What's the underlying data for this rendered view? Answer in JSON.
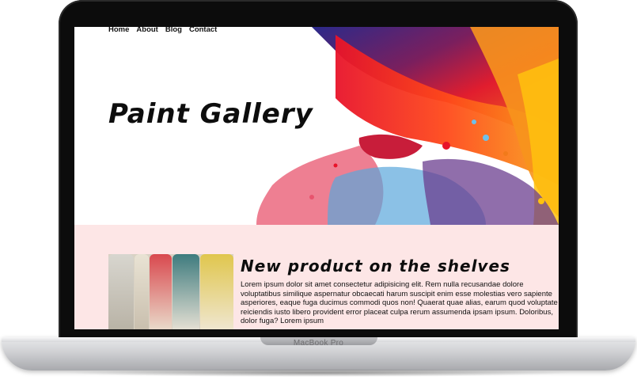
{
  "nav": {
    "items": [
      "Home",
      "About",
      "Blog",
      "Contact"
    ]
  },
  "hero": {
    "title": "Paint Gallery"
  },
  "section": {
    "heading": "New product on the shelves",
    "body": "Lorem ipsum dolor sit amet consectetur adipisicing elit. Rem nulla recusandae dolore voluptatibus similique aspernatur obcaecati harum suscipit enim esse molestias vero sapiente asperiores, eaque fuga ducimus commodi quos non! Quaerat quae alias, earum quod voluptate reiciendis iusto libero provident error placeat culpa rerum assumenda ipsam ipsum. Doloribus, dolor fuga? Lorem ipsum"
  },
  "device": {
    "label": "MacBook Pro"
  },
  "colors": {
    "section_bg": "#fde6e6",
    "frame": "#0c0c0c"
  }
}
